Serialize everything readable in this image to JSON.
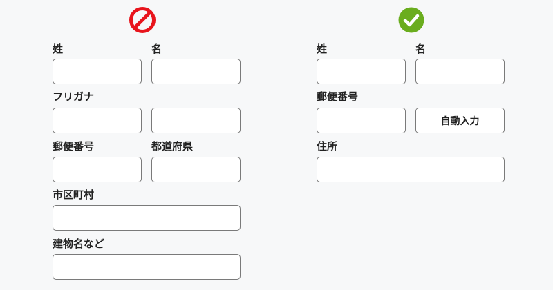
{
  "colors": {
    "bad": "#e8141c",
    "good": "#6aad1e",
    "field_border": "#7a7a7a",
    "background": "#f7f8f9"
  },
  "bad_example": {
    "icon": "prohibited-icon",
    "last_name_label": "姓",
    "first_name_label": "名",
    "furigana_label": "フリガナ",
    "postal_code_label": "郵便番号",
    "prefecture_label": "都道府県",
    "city_label": "市区町村",
    "building_label": "建物名など"
  },
  "good_example": {
    "icon": "checkmark-icon",
    "last_name_label": "姓",
    "first_name_label": "名",
    "postal_code_label": "郵便番号",
    "autofill_button_label": "自動入力",
    "address_label": "住所"
  }
}
